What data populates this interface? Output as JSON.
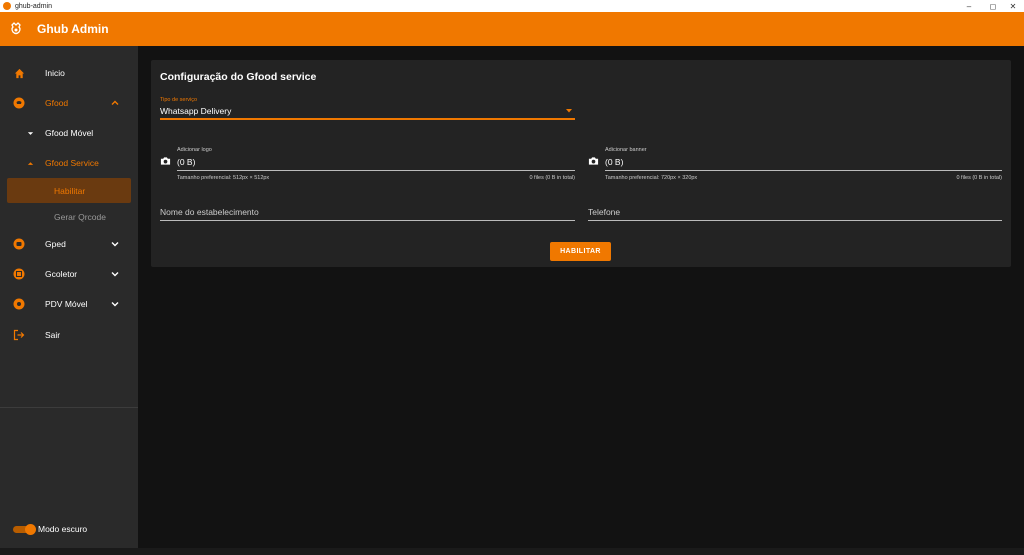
{
  "window": {
    "title": "ghub-admin",
    "minimize": "–",
    "maximize": "◻",
    "close": "✕"
  },
  "appbar": {
    "title": "Ghub Admin"
  },
  "sidebar": {
    "items": [
      {
        "label": "Inicio"
      },
      {
        "label": "Gfood"
      },
      {
        "label": "Gfood Móvel"
      },
      {
        "label": "Gfood Service"
      },
      {
        "label": "Habilitar"
      },
      {
        "label": "Gerar Qrcode"
      },
      {
        "label": "Gped"
      },
      {
        "label": "Gcoletor"
      },
      {
        "label": "PDV Móvel"
      },
      {
        "label": "Sair"
      }
    ],
    "dark_mode_label": "Modo escuro",
    "dark_mode_on": true
  },
  "card": {
    "title": "Configuração do Gfood service",
    "service_type": {
      "label": "Tipo de serviço",
      "value": "Whatsapp Delivery"
    },
    "logo": {
      "label": "Adicionar logo",
      "value": "(0 B)",
      "hint": "Tamanho preferencial: 512px × 512px",
      "count": "0 files (0 B in total)"
    },
    "banner": {
      "label": "Adicionar banner",
      "value": "(0 B)",
      "hint": "Tamanho preferencial: 720px × 320px",
      "count": "0 files (0 B in total)"
    },
    "establishment_name": {
      "placeholder": "Nome do estabelecimento"
    },
    "phone": {
      "placeholder": "Telefone"
    },
    "submit_label": "HABILITAR"
  },
  "colors": {
    "accent": "#f07800",
    "background": "#121212",
    "sidebar": "#2a2a2a",
    "card": "#232323"
  }
}
